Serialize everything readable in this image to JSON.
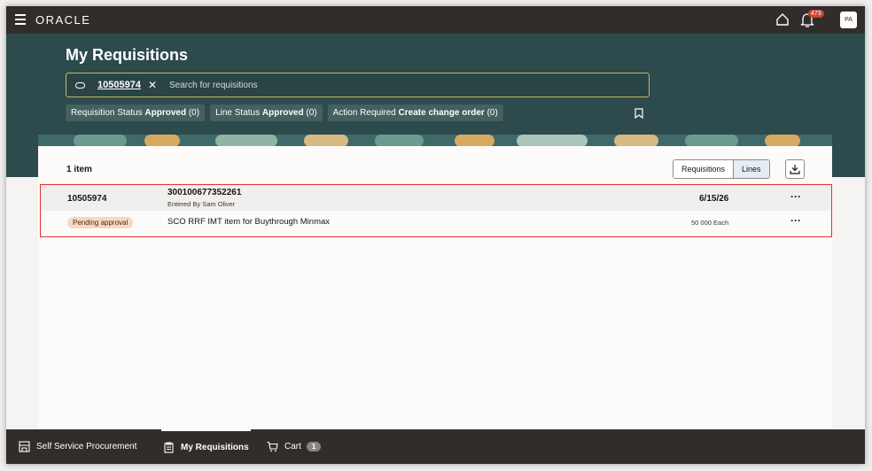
{
  "topbar": {
    "brand": "ORACLE",
    "notification_count": "473",
    "avatar_initials": "PA"
  },
  "header": {
    "title": "My Requisitions",
    "search": {
      "chip": "10505974",
      "placeholder": "Search for requisitions"
    },
    "filters": [
      {
        "label": "Requisition Status",
        "value": "Approved",
        "count": "(0)"
      },
      {
        "label": "Line Status",
        "value": "Approved",
        "count": "(0)"
      },
      {
        "label": "Action Required",
        "value": "Create change order",
        "count": "(0)"
      }
    ]
  },
  "results": {
    "count_label": "1 item",
    "view_toggle": {
      "requisitions": "Requisitions",
      "lines": "Lines",
      "selected": "Lines"
    },
    "rows": [
      {
        "requisition": "10505974",
        "requisition_id": "300100677352261",
        "entered_by": "Entered By Sam Oliver",
        "date": "6/15/26",
        "status": "Pending approval",
        "line_description": "SCO RRF IMT item for Buythrough Minmax",
        "quantity": "50 000 Each"
      }
    ]
  },
  "bottom_nav": {
    "items": [
      {
        "label": "Self Service Procurement",
        "icon": "store-icon"
      },
      {
        "label": "My Requisitions",
        "icon": "clipboard-icon",
        "active": true
      },
      {
        "label": "Cart",
        "icon": "cart-icon",
        "badge": "1"
      }
    ]
  },
  "colors": {
    "topbar": "#312d2a",
    "header": "#2d4a4c",
    "highlight_border": "#e0322f",
    "status_badge": "#f7d8c2",
    "notification_badge": "#c74634"
  }
}
